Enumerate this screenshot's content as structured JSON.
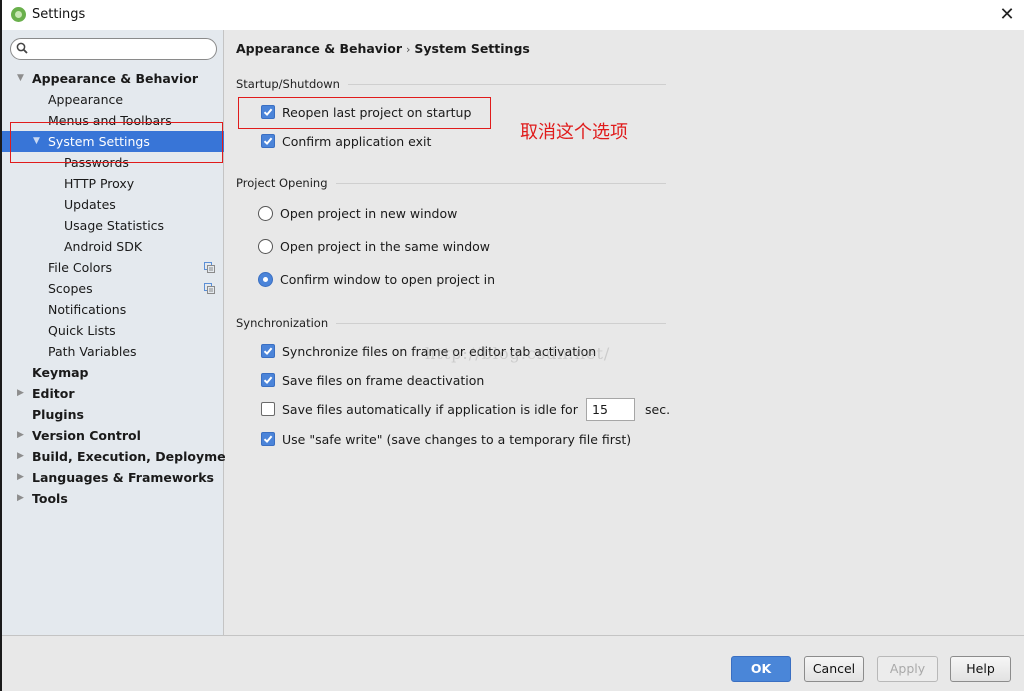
{
  "window": {
    "title": "Settings",
    "close_label": "✕"
  },
  "sidebar": {
    "search": {
      "placeholder": "",
      "value": ""
    },
    "items": [
      {
        "label": "Appearance & Behavior",
        "level": 0,
        "bold": true,
        "expandable": true,
        "expanded": true
      },
      {
        "label": "Appearance",
        "level": 1
      },
      {
        "label": "Menus and Toolbars",
        "level": 1
      },
      {
        "label": "System Settings",
        "level": 1,
        "expandable": true,
        "expanded": true,
        "selected": true
      },
      {
        "label": "Passwords",
        "level": 2
      },
      {
        "label": "HTTP Proxy",
        "level": 2
      },
      {
        "label": "Updates",
        "level": 2
      },
      {
        "label": "Usage Statistics",
        "level": 2
      },
      {
        "label": "Android SDK",
        "level": 2
      },
      {
        "label": "File Colors",
        "level": 1,
        "icon": "project-copy-icon"
      },
      {
        "label": "Scopes",
        "level": 1,
        "icon": "project-copy-icon"
      },
      {
        "label": "Notifications",
        "level": 1
      },
      {
        "label": "Quick Lists",
        "level": 1
      },
      {
        "label": "Path Variables",
        "level": 1
      },
      {
        "label": "Keymap",
        "level": 0,
        "bold": true
      },
      {
        "label": "Editor",
        "level": 0,
        "bold": true,
        "expandable": true
      },
      {
        "label": "Plugins",
        "level": 0,
        "bold": true
      },
      {
        "label": "Version Control",
        "level": 0,
        "bold": true,
        "expandable": true
      },
      {
        "label": "Build, Execution, Deployment",
        "level": 0,
        "bold": true,
        "expandable": true
      },
      {
        "label": "Languages & Frameworks",
        "level": 0,
        "bold": true,
        "expandable": true
      },
      {
        "label": "Tools",
        "level": 0,
        "bold": true,
        "expandable": true
      }
    ]
  },
  "breadcrumb": {
    "parent": "Appearance & Behavior",
    "separator": "›",
    "current": "System Settings"
  },
  "startup": {
    "title": "Startup/Shutdown",
    "reopen_label": "Reopen last project on startup",
    "reopen_checked": true,
    "confirm_exit_label": "Confirm application exit",
    "confirm_exit_checked": true
  },
  "project_opening": {
    "title": "Project Opening",
    "options": [
      {
        "label": "Open project in new window",
        "selected": false
      },
      {
        "label": "Open project in the same window",
        "selected": false
      },
      {
        "label": "Confirm window to open project in",
        "selected": true
      }
    ]
  },
  "sync": {
    "title": "Synchronization",
    "options": [
      {
        "label": "Synchronize files on frame or editor tab activation",
        "checked": true
      },
      {
        "label": "Save files on frame deactivation",
        "checked": true
      },
      {
        "label": "Save files automatically if application is idle for",
        "checked": false
      },
      {
        "label": "Use \"safe write\" (save changes to a temporary file first)",
        "checked": true
      }
    ],
    "idle_seconds": "15",
    "idle_unit": "sec."
  },
  "annotation": {
    "text": "取消这个选项",
    "color": "#e01b1b"
  },
  "watermark": "http://blog.csdn.net/",
  "footer": {
    "ok": "OK",
    "cancel": "Cancel",
    "apply": "Apply",
    "help": "Help"
  },
  "colors": {
    "accent": "#4a86d8",
    "selection": "#3875d7",
    "sidebar_bg": "#e4e9ee",
    "panel_bg": "#e8e8e8"
  }
}
